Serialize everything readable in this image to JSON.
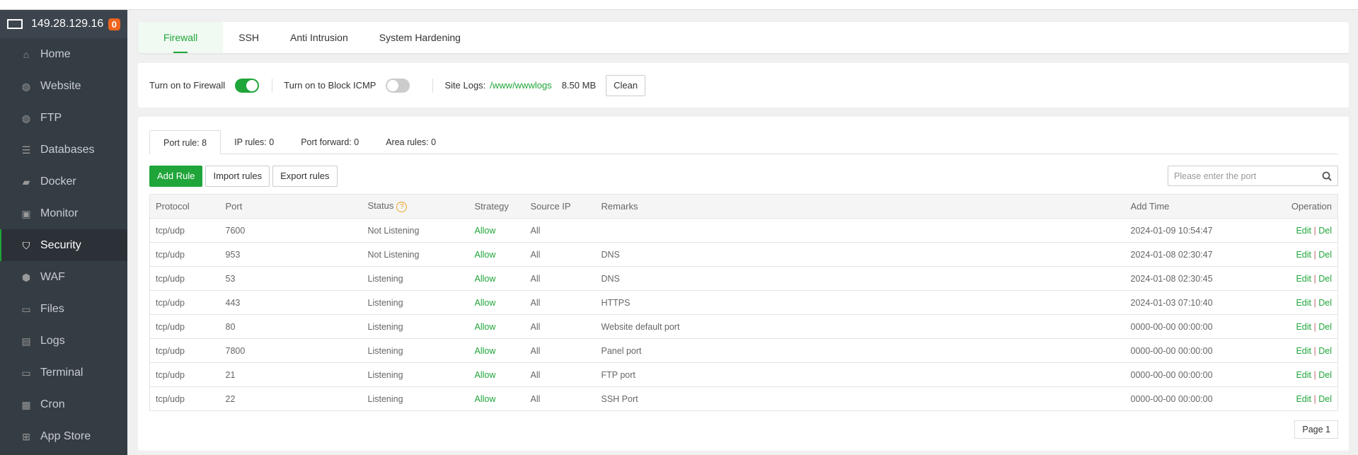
{
  "server": {
    "ip": "149.28.129.16",
    "badge": "0"
  },
  "sidebar": {
    "items": [
      {
        "label": "Home",
        "icon": "home-icon",
        "glyph": "⌂"
      },
      {
        "label": "Website",
        "icon": "globe-icon",
        "glyph": "◍"
      },
      {
        "label": "FTP",
        "icon": "ftp-icon",
        "glyph": "◍"
      },
      {
        "label": "Databases",
        "icon": "database-icon",
        "glyph": "☰"
      },
      {
        "label": "Docker",
        "icon": "docker-icon",
        "glyph": "▰"
      },
      {
        "label": "Monitor",
        "icon": "monitor-icon",
        "glyph": "▣"
      },
      {
        "label": "Security",
        "icon": "shield-icon",
        "glyph": "⛉"
      },
      {
        "label": "WAF",
        "icon": "waf-icon",
        "glyph": "⬢"
      },
      {
        "label": "Files",
        "icon": "folder-icon",
        "glyph": "▭"
      },
      {
        "label": "Logs",
        "icon": "logs-icon",
        "glyph": "▤"
      },
      {
        "label": "Terminal",
        "icon": "terminal-icon",
        "glyph": "▭"
      },
      {
        "label": "Cron",
        "icon": "calendar-icon",
        "glyph": "▦"
      },
      {
        "label": "App Store",
        "icon": "apps-icon",
        "glyph": "⊞"
      }
    ],
    "active": "Security"
  },
  "tabs": [
    "Firewall",
    "SSH",
    "Anti Intrusion",
    "System Hardening"
  ],
  "switches": {
    "firewall_label": "Turn on to Firewall",
    "firewall_on": true,
    "icmp_label": "Turn on to Block ICMP",
    "icmp_on": false,
    "site_logs_label": "Site Logs:",
    "site_logs_path": "/www/wwwlogs",
    "site_logs_size": "8.50 MB",
    "clean": "Clean"
  },
  "subtabs": [
    "Port rule: 8",
    "IP rules: 0",
    "Port forward: 0",
    "Area rules: 0"
  ],
  "toolbar": {
    "add": "Add Rule",
    "import": "Import rules",
    "export": "Export rules",
    "search_placeholder": "Please enter the port"
  },
  "table": {
    "headers": [
      "Protocol",
      "Port",
      "Status",
      "Strategy",
      "Source IP",
      "Remarks",
      "Add Time",
      "Operation"
    ],
    "help": "?",
    "edit": "Edit",
    "sep": "|",
    "del": "Del",
    "rows": [
      [
        "tcp/udp",
        "7600",
        "Not Listening",
        "Allow",
        "All",
        "",
        "2024-01-09 10:54:47"
      ],
      [
        "tcp/udp",
        "953",
        "Not Listening",
        "Allow",
        "All",
        "DNS",
        "2024-01-08 02:30:47"
      ],
      [
        "tcp/udp",
        "53",
        "Listening",
        "Allow",
        "All",
        "DNS",
        "2024-01-08 02:30:45"
      ],
      [
        "tcp/udp",
        "443",
        "Listening",
        "Allow",
        "All",
        "HTTPS",
        "2024-01-03 07:10:40"
      ],
      [
        "tcp/udp",
        "80",
        "Listening",
        "Allow",
        "All",
        "Website default port",
        "0000-00-00 00:00:00"
      ],
      [
        "tcp/udp",
        "7800",
        "Listening",
        "Allow",
        "All",
        "Panel port",
        "0000-00-00 00:00:00"
      ],
      [
        "tcp/udp",
        "21",
        "Listening",
        "Allow",
        "All",
        "FTP port",
        "0000-00-00 00:00:00"
      ],
      [
        "tcp/udp",
        "22",
        "Listening",
        "Allow",
        "All",
        "SSH Port",
        "0000-00-00 00:00:00"
      ]
    ]
  },
  "pager": "Page 1"
}
